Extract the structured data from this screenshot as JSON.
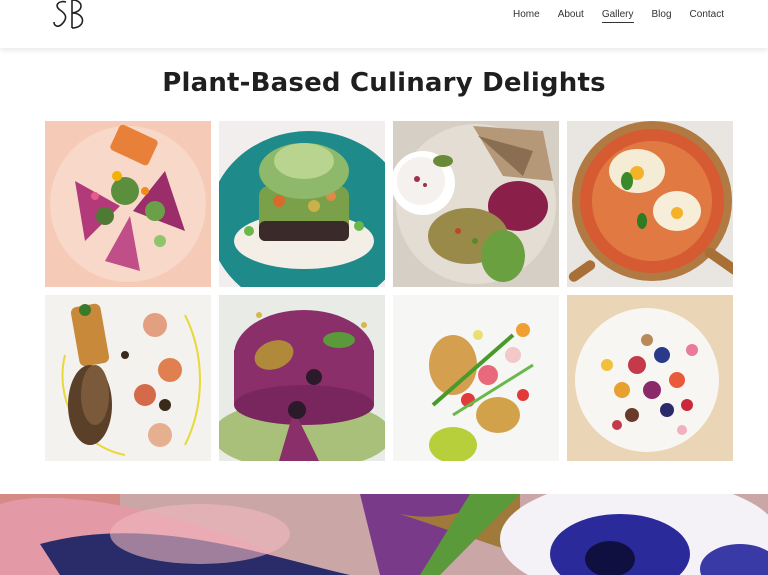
{
  "header": {
    "logo_text": "SB",
    "nav": [
      {
        "label": "Home",
        "active": false
      },
      {
        "label": "About",
        "active": false
      },
      {
        "label": "Gallery",
        "active": true
      },
      {
        "label": "Blog",
        "active": false
      },
      {
        "label": "Contact",
        "active": false
      }
    ]
  },
  "main": {
    "title": "Plant-Based Culinary Delights",
    "gallery_images": [
      {
        "subject": "pink plate with purple endive, orange crisp and flowers"
      },
      {
        "subject": "teal plate with layered tartare topped with microgreens"
      },
      {
        "subject": "grey platter with flatbread, yogurt, tabbouleh and beet dip"
      },
      {
        "subject": "copper pan shakshuka with eggs and jalapeno"
      },
      {
        "subject": "white plate with mushrooms, cracker and charred tomato"
      },
      {
        "subject": "pink beet terrine with blackberries and mint"
      },
      {
        "subject": "white plate with seared tofu, herb salad and green sauce"
      },
      {
        "subject": "yogurt bowl with colorful fruit, nuts and flowers"
      }
    ]
  },
  "colors": {
    "text": "#1f1f1f",
    "nav_text": "#333333",
    "header_bg": "#ffffff"
  }
}
